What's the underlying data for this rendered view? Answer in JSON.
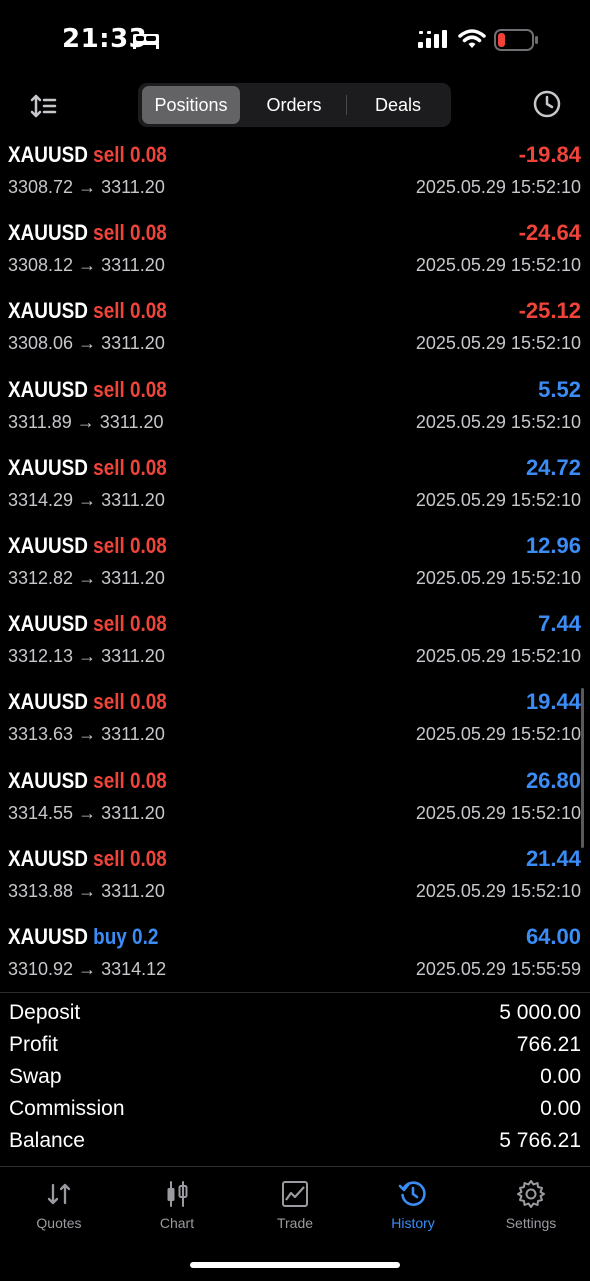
{
  "status_bar": {
    "time": "21:33"
  },
  "toolbar": {
    "segments": [
      "Positions",
      "Orders",
      "Deals"
    ],
    "active_segment": "Positions"
  },
  "deals": [
    {
      "symbol": "XAUUSD",
      "direction": "sell 0.08",
      "type": "sell",
      "open": "3308.72",
      "close": "3311.20",
      "profit": "-19.84",
      "time": "2025.05.29 15:52:10"
    },
    {
      "symbol": "XAUUSD",
      "direction": "sell 0.08",
      "type": "sell",
      "open": "3308.12",
      "close": "3311.20",
      "profit": "-24.64",
      "time": "2025.05.29 15:52:10"
    },
    {
      "symbol": "XAUUSD",
      "direction": "sell 0.08",
      "type": "sell",
      "open": "3308.06",
      "close": "3311.20",
      "profit": "-25.12",
      "time": "2025.05.29 15:52:10"
    },
    {
      "symbol": "XAUUSD",
      "direction": "sell 0.08",
      "type": "sell",
      "open": "3311.89",
      "close": "3311.20",
      "profit": "5.52",
      "time": "2025.05.29 15:52:10"
    },
    {
      "symbol": "XAUUSD",
      "direction": "sell 0.08",
      "type": "sell",
      "open": "3314.29",
      "close": "3311.20",
      "profit": "24.72",
      "time": "2025.05.29 15:52:10"
    },
    {
      "symbol": "XAUUSD",
      "direction": "sell 0.08",
      "type": "sell",
      "open": "3312.82",
      "close": "3311.20",
      "profit": "12.96",
      "time": "2025.05.29 15:52:10"
    },
    {
      "symbol": "XAUUSD",
      "direction": "sell 0.08",
      "type": "sell",
      "open": "3312.13",
      "close": "3311.20",
      "profit": "7.44",
      "time": "2025.05.29 15:52:10"
    },
    {
      "symbol": "XAUUSD",
      "direction": "sell 0.08",
      "type": "sell",
      "open": "3313.63",
      "close": "3311.20",
      "profit": "19.44",
      "time": "2025.05.29 15:52:10"
    },
    {
      "symbol": "XAUUSD",
      "direction": "sell 0.08",
      "type": "sell",
      "open": "3314.55",
      "close": "3311.20",
      "profit": "26.80",
      "time": "2025.05.29 15:52:10"
    },
    {
      "symbol": "XAUUSD",
      "direction": "sell 0.08",
      "type": "sell",
      "open": "3313.88",
      "close": "3311.20",
      "profit": "21.44",
      "time": "2025.05.29 15:52:10"
    },
    {
      "symbol": "XAUUSD",
      "direction": "buy 0.2",
      "type": "buy",
      "open": "3310.92",
      "close": "3314.12",
      "profit": "64.00",
      "time": "2025.05.29 15:55:59"
    }
  ],
  "summary": [
    {
      "label": "Deposit",
      "value": "5 000.00"
    },
    {
      "label": "Profit",
      "value": "766.21"
    },
    {
      "label": "Swap",
      "value": "0.00"
    },
    {
      "label": "Commission",
      "value": "0.00"
    },
    {
      "label": "Balance",
      "value": "5 766.21"
    }
  ],
  "tabs": [
    {
      "label": "Quotes",
      "icon": "quotes-icon"
    },
    {
      "label": "Chart",
      "icon": "chart-icon"
    },
    {
      "label": "Trade",
      "icon": "trade-icon"
    },
    {
      "label": "History",
      "icon": "history-icon",
      "active": true
    },
    {
      "label": "Settings",
      "icon": "settings-icon"
    }
  ],
  "colors": {
    "sell": "#f0443a",
    "buy": "#3b8cf5",
    "accent": "#3b8cf5",
    "background": "#000000"
  }
}
